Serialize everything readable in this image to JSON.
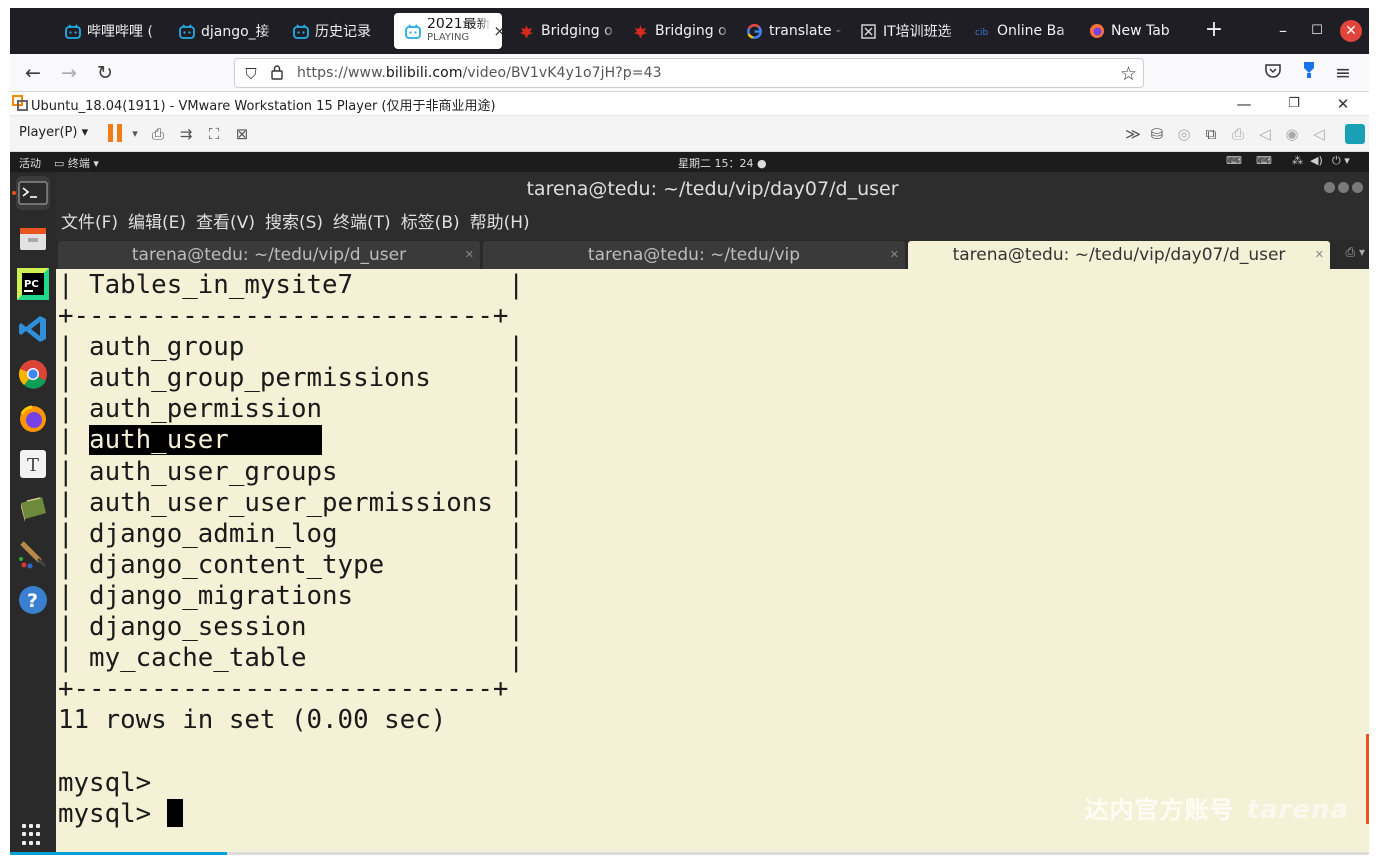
{
  "browser": {
    "tabs": [
      {
        "label": "哔哩哔哩 (",
        "icon": "bilibili-icon"
      },
      {
        "label": "django_接",
        "icon": "bilibili-icon"
      },
      {
        "label": "历史记录",
        "icon": "bilibili-icon"
      },
      {
        "label": "2021最新",
        "sublabel": "PLAYING",
        "icon": "bilibili-icon",
        "active": true
      },
      {
        "label": "Bridging o",
        "icon": "maple-leaf-icon"
      },
      {
        "label": "Bridging o",
        "icon": "maple-leaf-icon"
      },
      {
        "label": "translate -",
        "icon": "google-icon"
      },
      {
        "label": "IT培训班选",
        "icon": "it-icon"
      },
      {
        "label": "Online Ba",
        "icon": "bank-icon"
      },
      {
        "label": "New Tab",
        "icon": "firefox-icon"
      }
    ],
    "url": {
      "prefix": "https://www.",
      "domain": "bilibili.com",
      "path": "/video/BV1vK4y1o7jH?p=43"
    },
    "accent": "#e95420"
  },
  "vmware": {
    "title": "Ubuntu_18.04(1911) - VMware Workstation 15 Player (仅用于非商业用途)",
    "player_menu": "Player(P)"
  },
  "ubuntu": {
    "activities": "活动",
    "app_menu": "终端",
    "clock": "星期二 15：24"
  },
  "terminal": {
    "title": "tarena@tedu: ~/tedu/vip/day07/d_user",
    "menu": [
      "文件(F)",
      "编辑(E)",
      "查看(V)",
      "搜索(S)",
      "终端(T)",
      "标签(B)",
      "帮助(H)"
    ],
    "tabs": [
      {
        "label": "tarena@tedu: ~/tedu/vip/d_user"
      },
      {
        "label": "tarena@tedu: ~/tedu/vip"
      },
      {
        "label": "tarena@tedu: ~/tedu/vip/day07/d_user",
        "active": true
      }
    ],
    "table_header": "Tables_in_mysite7",
    "table_rows": [
      "auth_group",
      "auth_group_permissions",
      "auth_permission",
      "auth_user",
      "auth_user_groups",
      "auth_user_user_permissions",
      "django_admin_log",
      "django_content_type",
      "django_migrations",
      "django_session",
      "my_cache_table"
    ],
    "highlighted_row": "auth_user",
    "result": "11 rows in set (0.00 sec)",
    "prompt": "mysql>",
    "watermark": "达内官方账号"
  },
  "video_progress": 0.16
}
